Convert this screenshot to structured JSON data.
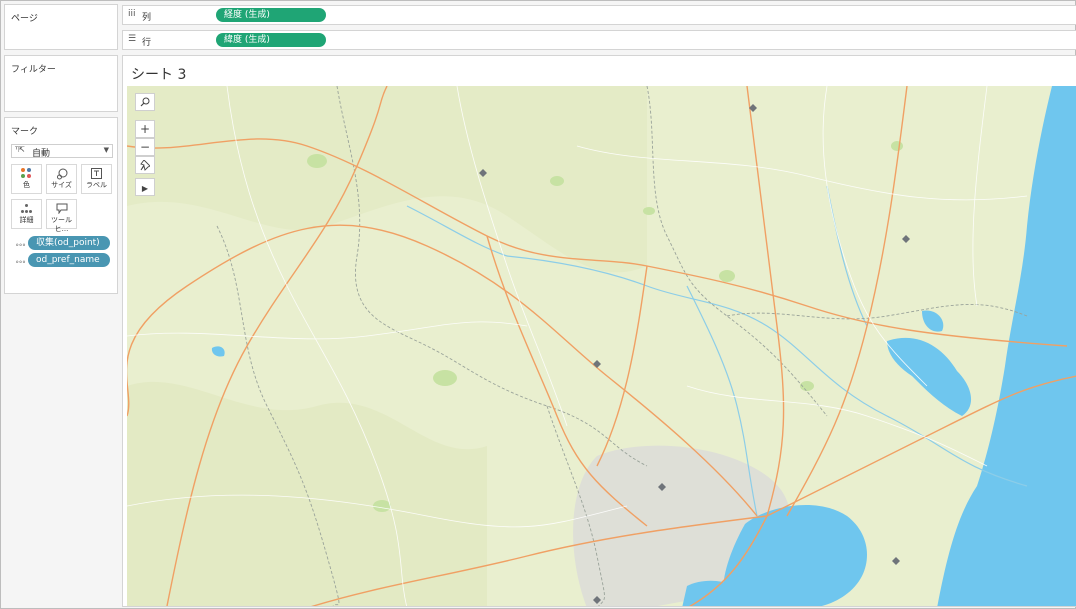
{
  "panels": {
    "pages_title": "ページ",
    "filters_title": "フィルター",
    "marks_title": "マーク"
  },
  "marks": {
    "mark_type": "自動",
    "buttons": {
      "color": "色",
      "size": "サイズ",
      "label": "ラベル",
      "detail": "詳細",
      "tooltip": "ツールヒ..."
    },
    "fields": [
      "収集(od_point)",
      "od_pref_name"
    ]
  },
  "shelves": {
    "columns_label": "列",
    "columns_pill": "経度 (生成)",
    "rows_label": "行",
    "rows_pill": "緯度 (生成)"
  },
  "sheet": {
    "title": "シート 3"
  },
  "colors": {
    "pill_green": "#1fa575",
    "pill_blue": "#4996b2",
    "map_land": "#eaefcf",
    "map_water": "#6fc6ee",
    "map_roads": "#f2a065",
    "map_point": "#6f747a"
  }
}
